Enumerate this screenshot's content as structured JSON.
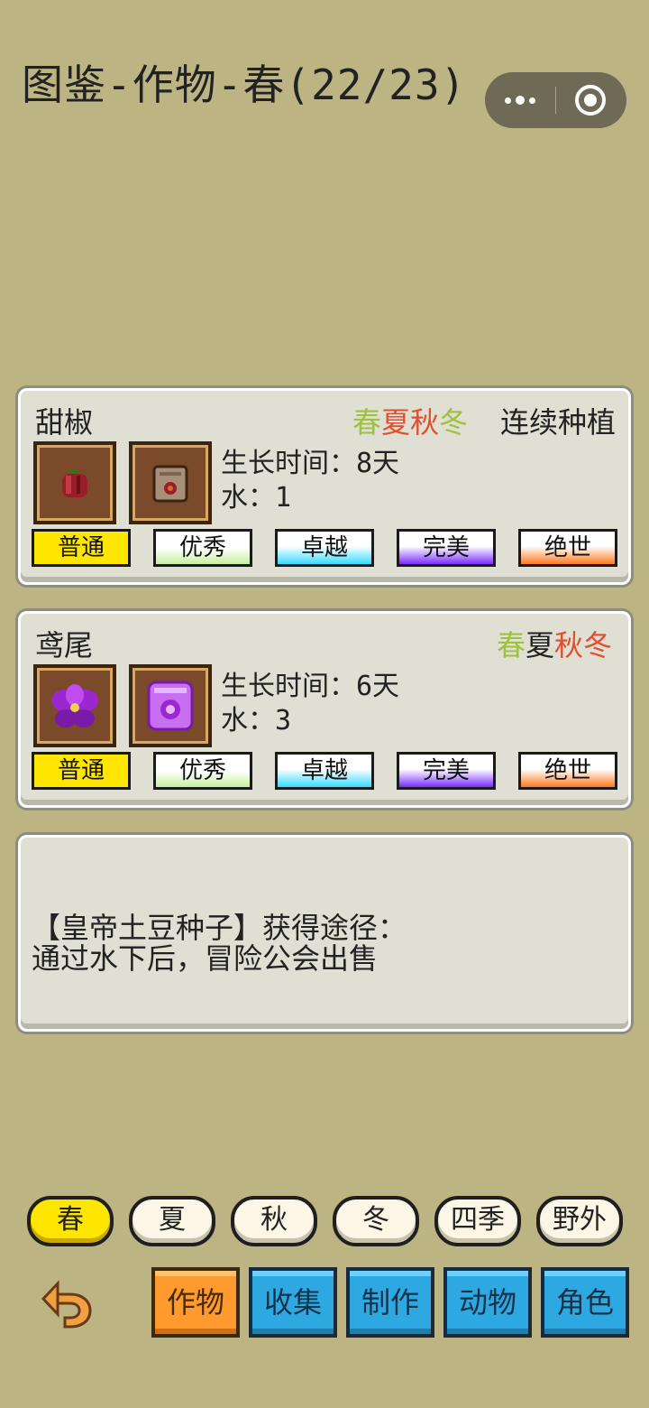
{
  "header": {
    "title": "图鉴-作物-春(22/23)"
  },
  "crops": [
    {
      "name": "甜椒",
      "seasons": [
        {
          "label": "春",
          "color": "#a0c040"
        },
        {
          "label": "夏",
          "color": "#e05030"
        },
        {
          "label": "秋",
          "color": "#e05030"
        },
        {
          "label": "冬",
          "color": "#a0c040"
        }
      ],
      "tag": "连续种植",
      "growth_text": "生长时间：8天",
      "water_text": "水：1",
      "crop_icon": "pepper-icon",
      "seed_icon": "seed-bag-icon"
    },
    {
      "name": "鸢尾",
      "seasons": [
        {
          "label": "春",
          "color": "#a0c040"
        },
        {
          "label": "夏",
          "color": "#222222"
        },
        {
          "label": "秋",
          "color": "#e05030"
        },
        {
          "label": "冬",
          "color": "#e05030"
        }
      ],
      "tag": "",
      "growth_text": "生长时间：6天",
      "water_text": "水：3",
      "crop_icon": "iris-flower-icon",
      "seed_icon": "iris-seed-bag-icon"
    }
  ],
  "quality_labels": [
    "普通",
    "优秀",
    "卓越",
    "完美",
    "绝世"
  ],
  "info": {
    "line1": "【皇帝土豆种子】获得途径：",
    "line2": "通过水下后，冒险公会出售"
  },
  "season_tabs": [
    "春",
    "夏",
    "秋",
    "冬",
    "四季",
    "野外"
  ],
  "category_tabs": [
    "作物",
    "收集",
    "制作",
    "动物",
    "角色"
  ],
  "colors": {
    "background": "#bdb484",
    "active_tab": "#ffe600",
    "category_active": "#ff9a2e",
    "category": "#2ea8e0"
  }
}
